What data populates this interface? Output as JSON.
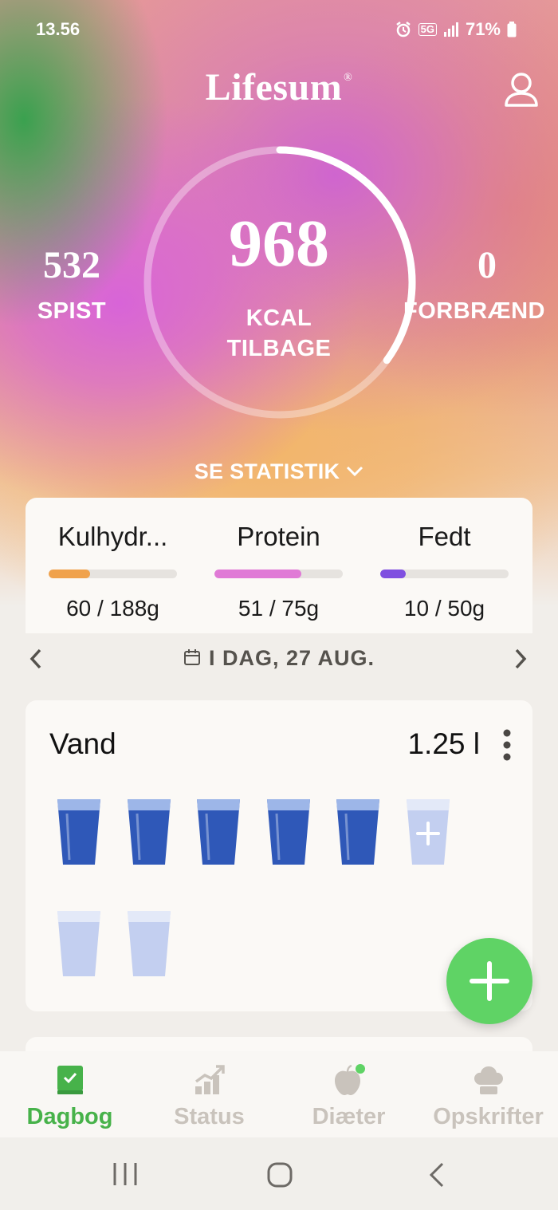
{
  "status_bar": {
    "time": "13.56",
    "battery": "71%",
    "network": "5G",
    "icons": [
      "alarm-icon",
      "5g-icon",
      "signal-icon",
      "battery-icon"
    ]
  },
  "header": {
    "logo": "Lifesum",
    "logo_mark": "®",
    "profile_icon": "profile-icon"
  },
  "summary": {
    "eaten_value": "532",
    "eaten_label": "SPIST",
    "remaining_value": "968",
    "remaining_label_line1": "KCAL",
    "remaining_label_line2": "TILBAGE",
    "burned_value": "0",
    "burned_label": "FORBRÆND",
    "ring_progress": 0.35,
    "see_stats": "SE STATISTIK"
  },
  "macros": [
    {
      "name": "Kulhydr...",
      "value": "60 / 188g",
      "progress": 0.32,
      "color": "#f0a24c"
    },
    {
      "name": "Protein",
      "value": "51 / 75g",
      "progress": 0.68,
      "color": "#e07ad6"
    },
    {
      "name": "Fedt",
      "value": "10 / 50g",
      "progress": 0.2,
      "color": "#7f4fe0"
    }
  ],
  "date_nav": {
    "label": "I DAG, 27 AUG."
  },
  "water": {
    "title": "Vand",
    "amount": "1.25 l",
    "glasses": [
      "full",
      "full",
      "full",
      "full",
      "full",
      "add",
      "empty",
      "empty"
    ]
  },
  "bottom_nav": [
    {
      "label": "Dagbog",
      "icon": "diary-icon",
      "active": true
    },
    {
      "label": "Status",
      "icon": "progress-chart-icon",
      "active": false
    },
    {
      "label": "Diæter",
      "icon": "apple-icon",
      "active": false
    },
    {
      "label": "Opskrifter",
      "icon": "chef-hat-icon",
      "active": false
    }
  ],
  "colors": {
    "accent_green": "#5fd365",
    "nav_active": "#47b24a",
    "nav_inactive": "#c9c3bc"
  }
}
